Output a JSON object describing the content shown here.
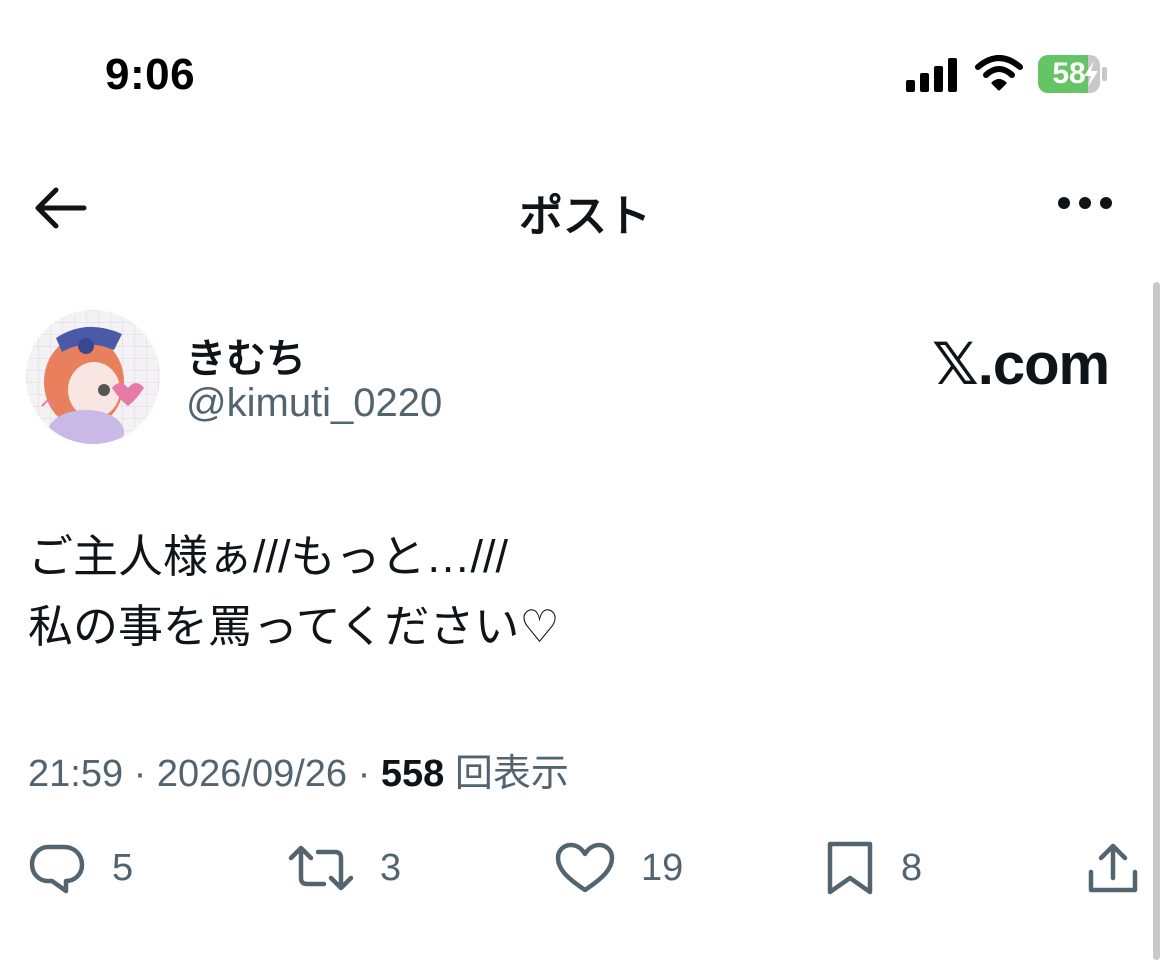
{
  "status_bar": {
    "time": "9:06",
    "battery": "58"
  },
  "nav": {
    "title": "ポスト"
  },
  "author": {
    "name": "きむち",
    "handle": "@kimuti_0220"
  },
  "watermark": "𝕏.com",
  "tweet": {
    "lines": [
      "ご主人様ぁ///もっと…///",
      "私の事を罵ってください♡"
    ],
    "time": "21:59",
    "date": "2026/09/26",
    "views": "558",
    "views_label": "回表示",
    "separator": " · "
  },
  "actions": {
    "replies": "5",
    "retweets": "3",
    "likes": "19",
    "bookmarks": "8"
  },
  "colors": {
    "text": "#0f1419",
    "secondary": "#536471",
    "battery_green": "#65c466"
  }
}
